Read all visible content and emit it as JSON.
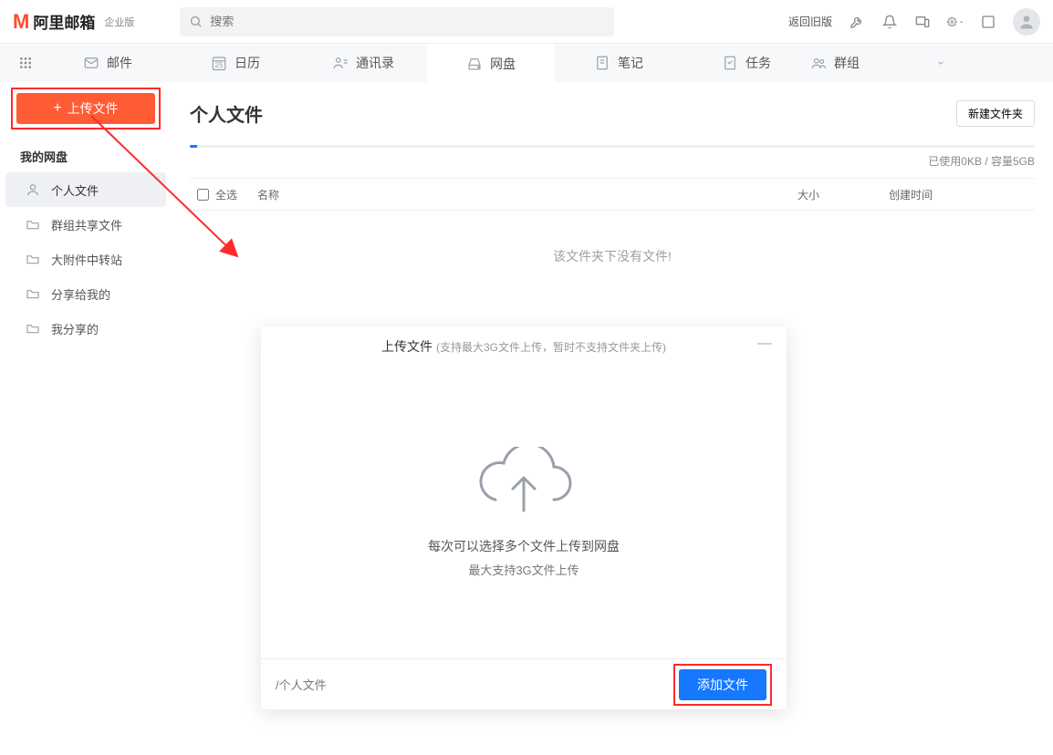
{
  "header": {
    "brand": "阿里邮箱",
    "brand_sub": "企业版",
    "search_placeholder": "搜索",
    "back_old": "返回旧版"
  },
  "navtabs": {
    "mail": "邮件",
    "calendar": "日历",
    "calendar_day": "25",
    "contacts": "通讯录",
    "disk": "网盘",
    "notes": "笔记",
    "tasks": "任务",
    "groups": "群组"
  },
  "sidebar": {
    "upload_btn": "上传文件",
    "section": "我的网盘",
    "items": [
      "个人文件",
      "群组共享文件",
      "大附件中转站",
      "分享给我的",
      "我分享的"
    ]
  },
  "page": {
    "title": "个人文件"
  },
  "toolbar": {
    "new_folder": "新建文件夹"
  },
  "quota": {
    "text": "已使用0KB / 容量5GB"
  },
  "table": {
    "select_all": "全选",
    "name": "名称",
    "size": "大小",
    "ctime": "创建时间",
    "empty": "该文件夹下没有文件!"
  },
  "modal": {
    "title": "上传文件",
    "title_sub": "(支持最大3G文件上传，暂时不支持文件夹上传)",
    "line1": "每次可以选择多个文件上传到网盘",
    "line2": "最大支持3G文件上传",
    "breadcrumb": "/个人文件",
    "add_file": "添加文件"
  }
}
